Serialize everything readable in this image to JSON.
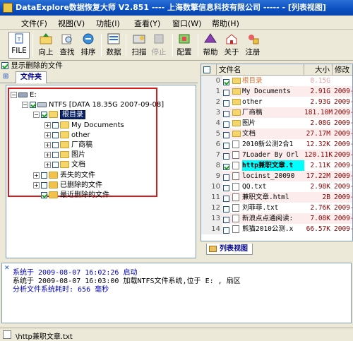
{
  "window": {
    "title": "DataExplore数据恢复大师 V2.851  ---- 上海数擎信息科技有限公司 ----- - [列表视图]"
  },
  "menu": [
    "文件(F)",
    "视图(V)",
    "功能(I)",
    "查看(Y)",
    "窗口(W)",
    "帮助(H)"
  ],
  "toolbar": [
    {
      "label": "FILE",
      "icon": "file-icon",
      "enabled": true
    },
    {
      "label": "向上",
      "icon": "folder-up-icon",
      "enabled": true
    },
    {
      "label": "查找",
      "icon": "search-icon",
      "enabled": true
    },
    {
      "label": "排序",
      "icon": "sort-icon",
      "enabled": true
    },
    {
      "label": "数据",
      "icon": "data-icon",
      "enabled": true
    },
    {
      "label": "扫描",
      "icon": "scan-icon",
      "enabled": true
    },
    {
      "label": "停止",
      "icon": "stop-icon",
      "enabled": false
    },
    {
      "label": "配置",
      "icon": "config-icon",
      "enabled": true
    },
    {
      "label": "帮助",
      "icon": "help-icon",
      "enabled": true
    },
    {
      "label": "关于",
      "icon": "about-icon",
      "enabled": true
    },
    {
      "label": "注册",
      "icon": "register-icon",
      "enabled": true
    }
  ],
  "left": {
    "show_deleted": "显示删除的文件",
    "tab": "文件夹",
    "tree": [
      {
        "label": "E:",
        "type": "drive"
      },
      {
        "label": "NTFS [DATA 18.35G 2007-09-08]",
        "type": "partition"
      },
      {
        "label": "根目录",
        "type": "folder"
      },
      {
        "label": "My Documents",
        "type": "folder"
      },
      {
        "label": "other",
        "type": "folder"
      },
      {
        "label": "厂商稿",
        "type": "folder"
      },
      {
        "label": "图片",
        "type": "folder"
      },
      {
        "label": "文档",
        "type": "folder"
      },
      {
        "label": "丢失的文件",
        "type": "special"
      },
      {
        "label": "已删除的文件",
        "type": "special"
      },
      {
        "label": "最近删除的文件",
        "type": "special"
      }
    ]
  },
  "list": {
    "columns": [
      "文件名",
      "大小",
      "修改"
    ],
    "rows": [
      {
        "num": "0",
        "name": "根目录",
        "size": "8.15G",
        "date": "",
        "kind": "folder"
      },
      {
        "num": "1",
        "name": "My Documents",
        "size": "2.91G",
        "date": "2009-",
        "kind": "folder"
      },
      {
        "num": "2",
        "name": "other",
        "size": "2.93G",
        "date": "2009-",
        "kind": "folder"
      },
      {
        "num": "3",
        "name": "厂商稿",
        "size": "181.10M",
        "date": "2009-",
        "kind": "folder"
      },
      {
        "num": "4",
        "name": "图片",
        "size": "2.08G",
        "date": "2009-",
        "kind": "folder"
      },
      {
        "num": "5",
        "name": "文档",
        "size": "27.17M",
        "date": "2009-",
        "kind": "folder"
      },
      {
        "num": "6",
        "name": "2010新公测2合1",
        "size": "12.32K",
        "date": "2009-",
        "kind": "file"
      },
      {
        "num": "7",
        "name": "7Loader By Orl",
        "size": "120.11K",
        "date": "2009-",
        "kind": "file"
      },
      {
        "num": "8",
        "name": "http兼职文章.t",
        "size": "2.11K",
        "date": "2009-",
        "kind": "file"
      },
      {
        "num": "9",
        "name": "locinst_20090",
        "size": "17.22M",
        "date": "2009-",
        "kind": "file"
      },
      {
        "num": "10",
        "name": "QQ.txt",
        "size": "2.98K",
        "date": "2009-",
        "kind": "file"
      },
      {
        "num": "11",
        "name": "兼职文章.html",
        "size": "2B",
        "date": "2009-",
        "kind": "file"
      },
      {
        "num": "12",
        "name": "刘菲菲.txt",
        "size": "2.76K",
        "date": "2009-",
        "kind": "file"
      },
      {
        "num": "13",
        "name": "新浪点点通阅读:",
        "size": "7.08K",
        "date": "2009-",
        "kind": "file"
      },
      {
        "num": "14",
        "name": "熊猫2010公测.x",
        "size": "66.57K",
        "date": "2009-",
        "kind": "file"
      }
    ],
    "tab": "列表视图"
  },
  "log": [
    {
      "prefix": "系统于 ",
      "time": "2009-08-07 16:02:26",
      "text": " 启动",
      "color": "#0000c0"
    },
    {
      "prefix": "系统于 ",
      "time": "2009-08-07 16:03:00",
      "text": " 加载NTFS文件系统,位于 E: ,  扇区",
      "color": "#000000"
    },
    {
      "prefix": "",
      "time": "",
      "text": "分析文件系统耗时: 656 毫秒",
      "color": "#0000c0"
    }
  ],
  "status": {
    "text": "\\http兼职文章.txt"
  }
}
